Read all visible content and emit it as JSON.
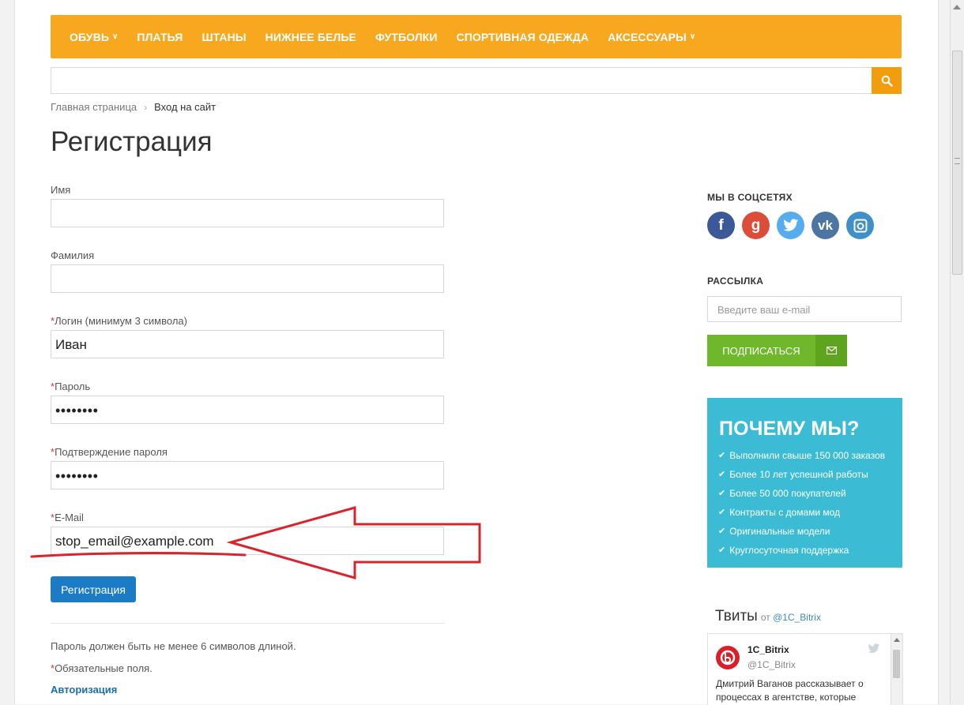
{
  "nav": {
    "items": [
      {
        "label": "ОБУВЬ",
        "has_dropdown": true
      },
      {
        "label": "ПЛАТЬЯ",
        "has_dropdown": false
      },
      {
        "label": "ШТАНЫ",
        "has_dropdown": false
      },
      {
        "label": "НИЖНЕЕ БЕЛЬЕ",
        "has_dropdown": false
      },
      {
        "label": "ФУТБОЛКИ",
        "has_dropdown": false
      },
      {
        "label": "СПОРТИВНАЯ ОДЕЖДА",
        "has_dropdown": false
      },
      {
        "label": "АКСЕССУАРЫ",
        "has_dropdown": true
      }
    ],
    "color": "#f8a81e"
  },
  "search": {
    "value": "",
    "icon": "search-icon"
  },
  "breadcrumb": {
    "home": "Главная страница",
    "current": "Вход на сайт"
  },
  "page_title": "Регистрация",
  "form": {
    "fields": [
      {
        "label": "Имя",
        "required": false,
        "value": ""
      },
      {
        "label": "Фамилия",
        "required": false,
        "value": ""
      },
      {
        "label": "Логин (минимум 3 символа)",
        "required": true,
        "value": "Иван"
      },
      {
        "label": "Пароль",
        "required": true,
        "value": "••••••••"
      },
      {
        "label": "Подтверждение пароля",
        "required": true,
        "value": "••••••••"
      },
      {
        "label": "E-Mail",
        "required": true,
        "value": "stop_email@example.com"
      }
    ],
    "required_mark": "*",
    "submit_label": "Регистрация",
    "password_note": "Пароль должен быть не менее 6 символов длиной.",
    "required_note": "Обязательные поля.",
    "auth_link": "Авторизация"
  },
  "sidebar": {
    "social_title": "МЫ В СОЦСЕТЯХ",
    "social": [
      {
        "icon": "facebook-icon",
        "glyph": "f",
        "color": "#3b5998"
      },
      {
        "icon": "google-plus-icon",
        "glyph": "g",
        "color": "#dd4b39"
      },
      {
        "icon": "twitter-icon",
        "glyph": "t",
        "color": "#55acee"
      },
      {
        "icon": "vk-icon",
        "glyph": "vk",
        "color": "#4c75a3"
      },
      {
        "icon": "instagram-icon",
        "glyph": "◎",
        "color": "#3f8fc9"
      }
    ],
    "newsletter_title": "РАССЫЛКА",
    "newsletter_placeholder": "Введите ваш e-mail",
    "subscribe_label": "ПОДПИСАТЬСЯ",
    "why": {
      "title": "ПОЧЕМУ МЫ?",
      "items": [
        "Выполнили свыше 150 000 заказов",
        "Более 10 лет успешной работы",
        "Более 50 000 покупателей",
        "Контракты с домами мод",
        "Оригинальные модели",
        "Круглосуточная поддержка"
      ]
    },
    "tweets": {
      "title": "Твиты",
      "from": "от",
      "account_link": "@1C_Bitrix",
      "tweet": {
        "name": "1C_Bitrix",
        "handle": "@1C_Bitrix",
        "text": "Дмитрий Ваганов рассказывает о процессах в агентстве, которые"
      }
    }
  },
  "annotation": {
    "color": "#d9232d"
  }
}
